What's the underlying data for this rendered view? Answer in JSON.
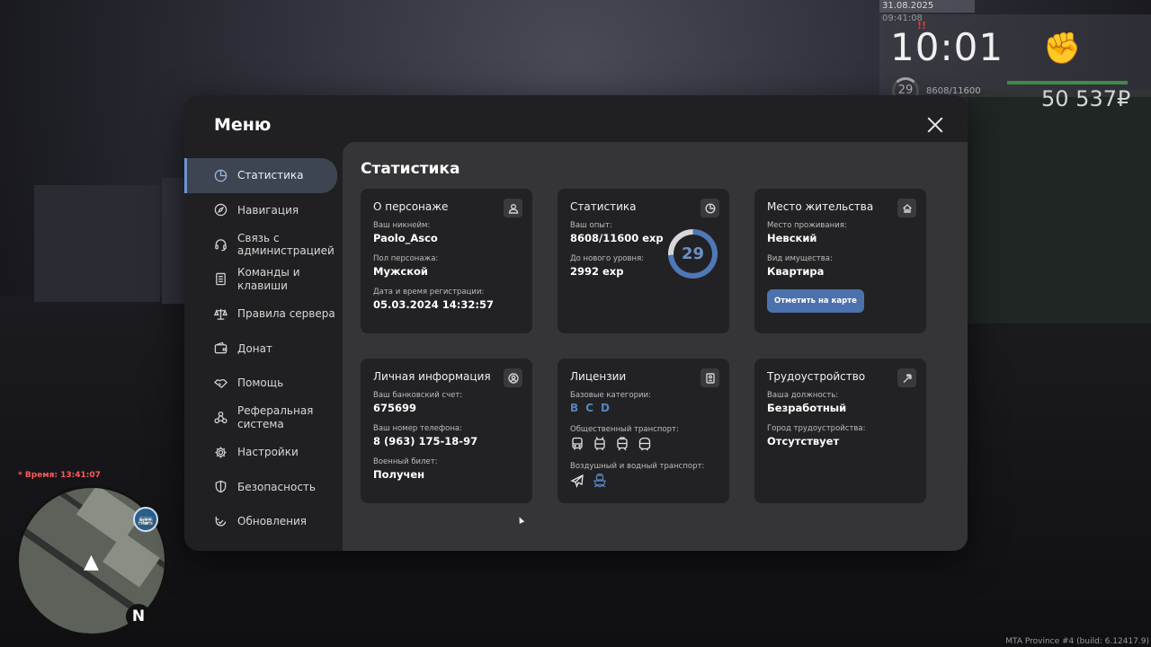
{
  "hud": {
    "datetime": "31.08.2025 09:41:08",
    "alert_mark": "!!",
    "clock": "10:01",
    "level": "29",
    "exp": "8608/11600",
    "money": "50 537₽",
    "server_time": "* Время: 13:41:07",
    "build": "MTA Province #4 (build: 6.12417.9)",
    "north": "N"
  },
  "menu": {
    "title": "Меню",
    "close_icon": "close-icon"
  },
  "sidebar": {
    "items": [
      {
        "label": "Статистика",
        "icon": "pie-chart-icon",
        "active": true
      },
      {
        "label": "Навигация",
        "icon": "compass-icon"
      },
      {
        "label": "Связь с администрацией",
        "icon": "headset-icon"
      },
      {
        "label": "Команды и клавиши",
        "icon": "document-icon"
      },
      {
        "label": "Правила сервера",
        "icon": "scales-icon"
      },
      {
        "label": "Донат",
        "icon": "wallet-icon"
      },
      {
        "label": "Помощь",
        "icon": "handshake-icon"
      },
      {
        "label": "Реферальная система",
        "icon": "network-icon"
      },
      {
        "label": "Настройки",
        "icon": "gear-icon"
      },
      {
        "label": "Безопасность",
        "icon": "shield-icon"
      },
      {
        "label": "Обновления",
        "icon": "refresh-icon"
      }
    ]
  },
  "content": {
    "title": "Статистика",
    "character": {
      "title": "О персонаже",
      "nickname_label": "Ваш никнейм:",
      "nickname": "Paolo_Asco",
      "gender_label": "Пол персонажа:",
      "gender": "Мужской",
      "reg_label": "Дата и время регистрации:",
      "reg": "05.03.2024 14:32:57"
    },
    "stats": {
      "title": "Статистика",
      "exp_label": "Ваш опыт:",
      "exp": "8608/11600 exp",
      "next_label": "До нового уровня:",
      "next": "2992 exp",
      "level": "29",
      "level_progress": 0.742
    },
    "residence": {
      "title": "Место жительства",
      "place_label": "Место проживания:",
      "place": "Невский",
      "property_label": "Вид имущества:",
      "property": "Квартира",
      "map_button": "Отметить на карте"
    },
    "personal": {
      "title": "Личная информация",
      "bank_label": "Ваш банковский счет:",
      "bank": "675699",
      "phone_label": "Ваш номер телефона:",
      "phone": "8 (963) 175-18-97",
      "military_label": "Военный билет:",
      "military": "Получен"
    },
    "licenses": {
      "title": "Лицензии",
      "base_label": "Базовые категории:",
      "base": [
        "B",
        "C",
        "D"
      ],
      "public_label": "Общественный транспорт:",
      "air_label": "Воздушный и водный транспорт:"
    },
    "employment": {
      "title": "Трудоустройство",
      "position_label": "Ваша должность:",
      "position": "Безработный",
      "city_label": "Город трудоустройства:",
      "city": "Отсутствует"
    }
  }
}
